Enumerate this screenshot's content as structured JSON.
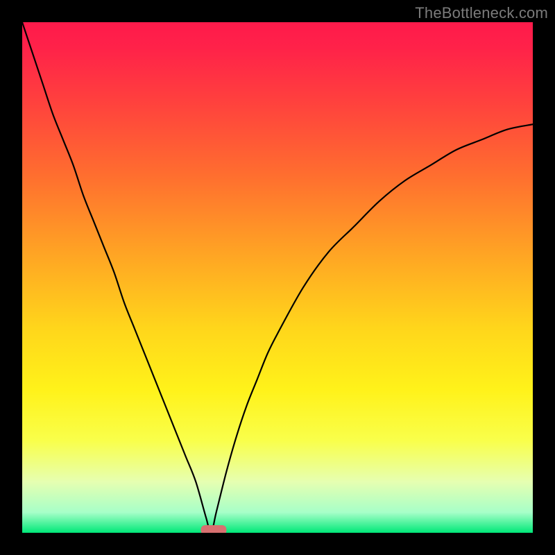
{
  "attribution": "TheBottleneck.com",
  "chart_data": {
    "type": "line",
    "title": "",
    "xlabel": "",
    "ylabel": "",
    "xlim": [
      0,
      100
    ],
    "ylim": [
      0,
      100
    ],
    "x": [
      0,
      2,
      4,
      6,
      8,
      10,
      12,
      14,
      16,
      18,
      20,
      22,
      24,
      26,
      28,
      30,
      32,
      34,
      36,
      37,
      38,
      40,
      42,
      44,
      46,
      48,
      50,
      55,
      60,
      65,
      70,
      75,
      80,
      85,
      90,
      95,
      100
    ],
    "values": [
      100,
      94,
      88,
      82,
      77,
      72,
      66,
      61,
      56,
      51,
      45,
      40,
      35,
      30,
      25,
      20,
      15,
      10,
      3,
      0,
      4,
      12,
      19,
      25,
      30,
      35,
      39,
      48,
      55,
      60,
      65,
      69,
      72,
      75,
      77,
      79,
      80
    ],
    "marker": {
      "x_range": [
        35,
        40
      ],
      "y": 0
    },
    "background_gradient": {
      "stops": [
        {
          "pos": 0.0,
          "color": "#ff1a4b"
        },
        {
          "pos": 0.05,
          "color": "#ff2249"
        },
        {
          "pos": 0.15,
          "color": "#ff3f3e"
        },
        {
          "pos": 0.3,
          "color": "#ff6e2f"
        },
        {
          "pos": 0.45,
          "color": "#ffa324"
        },
        {
          "pos": 0.6,
          "color": "#ffd61b"
        },
        {
          "pos": 0.72,
          "color": "#fff21a"
        },
        {
          "pos": 0.82,
          "color": "#f9ff4b"
        },
        {
          "pos": 0.9,
          "color": "#e6ffb1"
        },
        {
          "pos": 0.96,
          "color": "#a7ffc8"
        },
        {
          "pos": 1.0,
          "color": "#00e878"
        }
      ]
    }
  }
}
